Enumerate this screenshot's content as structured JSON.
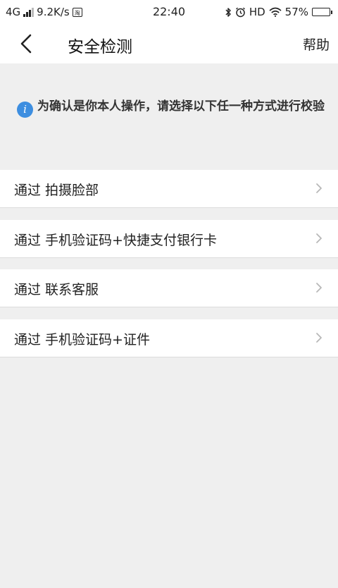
{
  "status_bar": {
    "network": "4G",
    "speed": "9.2K/s",
    "app_badge": "淘",
    "time": "22:40",
    "hd": "HD",
    "battery_pct": "57%",
    "battery_level": 0.57
  },
  "nav": {
    "title": "安全检测",
    "help": "帮助"
  },
  "notice": {
    "icon_glyph": "i",
    "text": "为确认是你本人操作，请选择以下任一种方式进行校验"
  },
  "options": [
    {
      "label": "通过 拍摄脸部"
    },
    {
      "label": "通过 手机验证码+快捷支付银行卡"
    },
    {
      "label": "通过 联系客服"
    },
    {
      "label": "通过 手机验证码+证件"
    }
  ],
  "colors": {
    "background": "#efefef",
    "surface": "#ffffff",
    "info_icon": "#3d8ee0",
    "chevron": "#b8b8b8"
  }
}
